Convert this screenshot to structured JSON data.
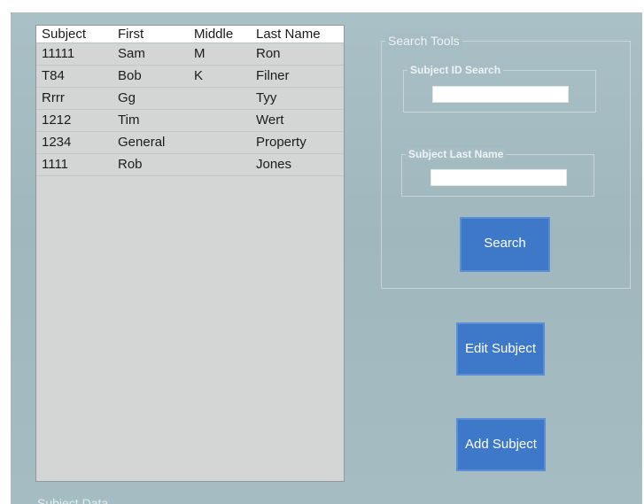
{
  "subject_list": {
    "columns": [
      "Subject",
      "First",
      "Middle",
      "Last Name"
    ],
    "rows": [
      {
        "subject": "11111",
        "first": "Sam",
        "middle": "M",
        "last": "Ron"
      },
      {
        "subject": "T84",
        "first": "Bob",
        "middle": "K",
        "last": "Filner"
      },
      {
        "subject": "Rrrr",
        "first": "Gg",
        "middle": "",
        "last": "Tyy"
      },
      {
        "subject": "1212",
        "first": "Tim",
        "middle": "",
        "last": "Wert"
      },
      {
        "subject": "1234",
        "first": "General",
        "middle": "",
        "last": "Property"
      },
      {
        "subject": "1111",
        "first": "Rob",
        "middle": "",
        "last": "Jones"
      }
    ]
  },
  "search_tools": {
    "title": "Search Tools",
    "id_search_label": "Subject ID Search",
    "id_search_value": "",
    "last_name_label": "Subject Last Name",
    "last_name_value": "",
    "search_button": "Search"
  },
  "actions": {
    "edit_button": "Edit Subject",
    "add_button": "Add Subject"
  },
  "subject_data_group": {
    "title": "Subject Data"
  },
  "colors": {
    "window_background": "#a6bdc3",
    "button_blue": "#3e78c9",
    "list_background": "#d4d6d6"
  }
}
